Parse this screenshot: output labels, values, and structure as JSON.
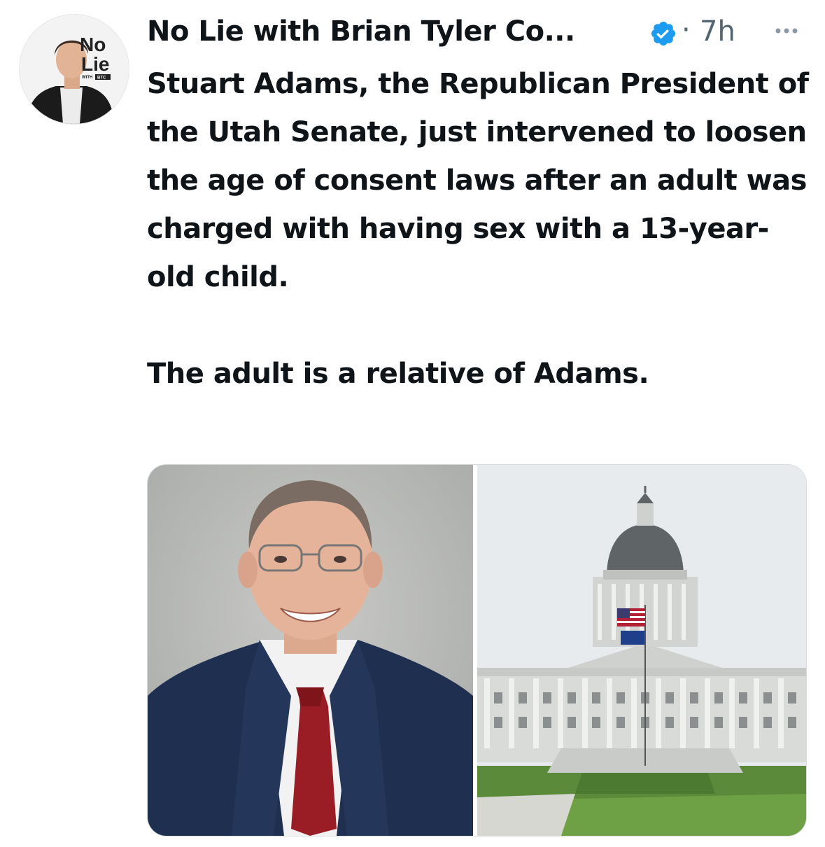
{
  "post": {
    "author": {
      "display_name": "No Lie with Brian Tyler Co...",
      "verified": true,
      "verified_icon": "verified-badge-icon",
      "avatar_text_line1": "No",
      "avatar_text_line2": "Lie",
      "avatar_tag_left": "WITH",
      "avatar_tag_right": "BTC"
    },
    "separator": "·",
    "timestamp": "7h",
    "more_icon": "more-options-icon",
    "text_paragraph_1": "Stuart Adams, the Republican President of the Utah Senate, just intervened to loosen the age of consent laws after an adult was charged with having sex with a 13-year-old child.",
    "text_paragraph_2": "The adult is a relative of Adams.",
    "media": [
      {
        "subject": "portrait-photo"
      },
      {
        "subject": "capitol-building-photo"
      }
    ]
  },
  "colors": {
    "text_primary": "#0f1419",
    "text_secondary": "#536471",
    "verified_blue": "#1d9bf0"
  }
}
